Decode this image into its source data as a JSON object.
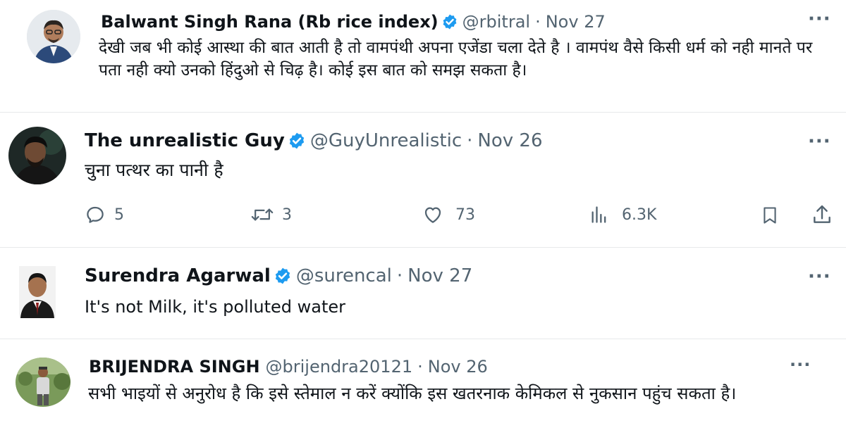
{
  "tweets": [
    {
      "name": "Balwant Singh Rana (Rb rice index)",
      "handle": "@rbitral",
      "dot": "·",
      "date": "Nov 27",
      "text": "देखी जब भी कोई आस्था की बात आती है तो वामपंथी अपना एजेंडा चला देते है । वामपंथ वैसे किसी धर्म को नही मानते पर पता नही क्यो उनको हिंदुओ से चिढ़ है। कोई इस बात को समझ सकता है।",
      "more": "···"
    },
    {
      "name": "The unrealistic Guy",
      "handle": "@GuyUnrealistic",
      "dot": "·",
      "date": "Nov 26",
      "text": "चुना पत्थर का पानी है",
      "more": "···",
      "actions": {
        "replies": "5",
        "retweets": "3",
        "likes": "73",
        "views": "6.3K"
      }
    },
    {
      "name": "Surendra Agarwal",
      "handle": "@surencal",
      "dot": "·",
      "date": "Nov 27",
      "text": "It's not Milk, it's polluted water",
      "more": "···"
    },
    {
      "name": "BRIJENDRA SINGH",
      "handle": "@brijendra20121",
      "dot": "·",
      "date": "Nov 26",
      "text": "सभी भाइयों से अनुरोध है कि इसे स्तेमाल न करें क्योंकि इस खतरनाक केमिकल से नुकसान पहुंच सकता है।",
      "more": "···"
    }
  ],
  "colors": {
    "verified": "#1d9bf0",
    "secondary_text": "#536471",
    "primary_text": "#0f1419"
  }
}
